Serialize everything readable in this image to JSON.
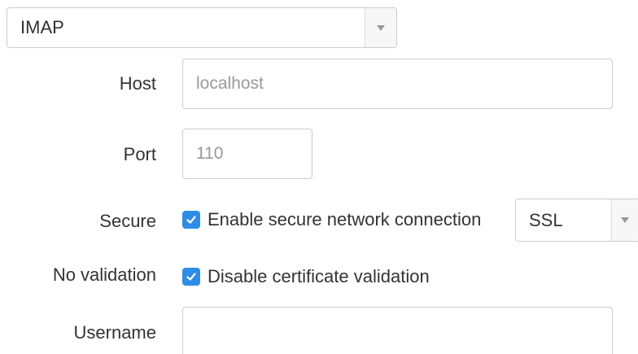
{
  "protocol": {
    "selected": "IMAP"
  },
  "host": {
    "label": "Host",
    "value": "",
    "placeholder": "localhost"
  },
  "port": {
    "label": "Port",
    "value": "",
    "placeholder": "110"
  },
  "secure": {
    "label": "Secure",
    "checkbox_label": "Enable secure network connection",
    "checked": true,
    "mode": "SSL"
  },
  "no_validation": {
    "label": "No validation",
    "checkbox_label": "Disable certificate validation",
    "checked": true
  },
  "username": {
    "label": "Username",
    "value": ""
  },
  "colors": {
    "checkbox": "#2e8de6",
    "border": "#cccccc",
    "placeholder": "#999999",
    "text": "#333333"
  },
  "icons": {
    "select_caret": "chevron-down-icon",
    "checkbox_check": "check-icon"
  }
}
